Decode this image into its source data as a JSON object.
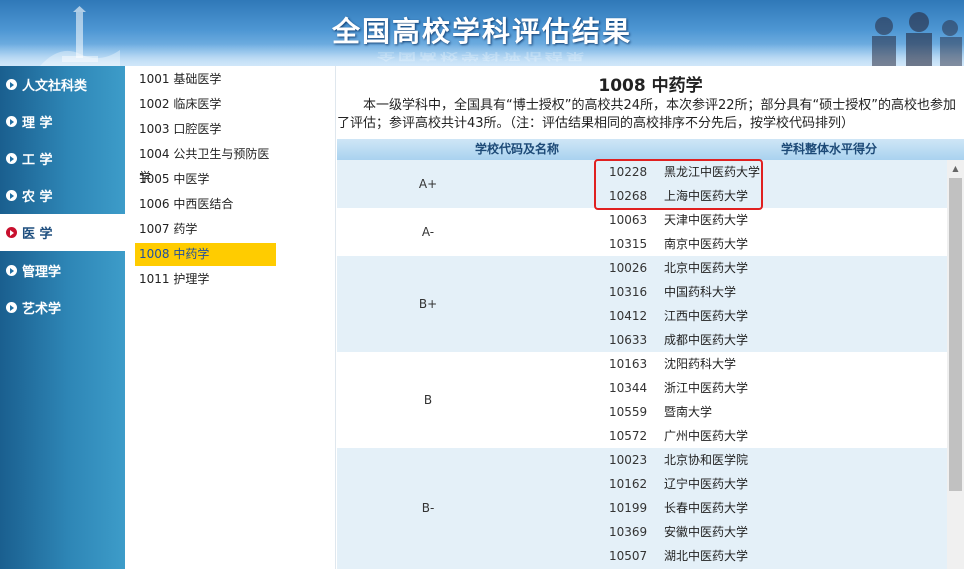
{
  "banner": {
    "title": "全国高校学科评估结果"
  },
  "left_nav": {
    "items": [
      {
        "label": "人文社科类",
        "active": false
      },
      {
        "label": "理 学",
        "active": false
      },
      {
        "label": "工 学",
        "active": false
      },
      {
        "label": "农 学",
        "active": false
      },
      {
        "label": "医 学",
        "active": true
      },
      {
        "label": "管理学",
        "active": false
      },
      {
        "label": "艺术学",
        "active": false
      }
    ]
  },
  "sub_list": {
    "items": [
      {
        "label": "1001 基础医学",
        "active": false
      },
      {
        "label": "1002 临床医学",
        "active": false
      },
      {
        "label": "1003 口腔医学",
        "active": false
      },
      {
        "label": "1004 公共卫生与预防医学",
        "active": false
      },
      {
        "label": "1005 中医学",
        "active": false
      },
      {
        "label": "1006 中西医结合",
        "active": false
      },
      {
        "label": "1007 药学",
        "active": false
      },
      {
        "label": "1008 中药学",
        "active": true
      },
      {
        "label": "1011 护理学",
        "active": false
      }
    ]
  },
  "main": {
    "heading": "1008 中药学",
    "description": "本一级学科中，全国具有“博士授权”的高校共24所，本次参评22所；部分具有“硕士授权”的高校也参加了评估；参评高校共计43所。（注：评估结果相同的高校排序不分先后，按学校代码排列）",
    "table": {
      "col_school": "学校代码及名称",
      "col_score": "学科整体水平得分",
      "groups": [
        {
          "grade": "A+",
          "shade": true,
          "rows": [
            {
              "code": "10228",
              "name": "黑龙江中医药大学"
            },
            {
              "code": "10268",
              "name": "上海中医药大学"
            }
          ]
        },
        {
          "grade": "A-",
          "shade": false,
          "rows": [
            {
              "code": "10063",
              "name": "天津中医药大学"
            },
            {
              "code": "10315",
              "name": "南京中医药大学"
            }
          ]
        },
        {
          "grade": "B+",
          "shade": true,
          "rows": [
            {
              "code": "10026",
              "name": "北京中医药大学"
            },
            {
              "code": "10316",
              "name": "中国药科大学"
            },
            {
              "code": "10412",
              "name": "江西中医药大学"
            },
            {
              "code": "10633",
              "name": "成都中医药大学"
            }
          ]
        },
        {
          "grade": "B",
          "shade": false,
          "rows": [
            {
              "code": "10163",
              "name": "沈阳药科大学"
            },
            {
              "code": "10344",
              "name": "浙江中医药大学"
            },
            {
              "code": "10559",
              "name": "暨南大学"
            },
            {
              "code": "10572",
              "name": "广州中医药大学"
            }
          ]
        },
        {
          "grade": "B-",
          "shade": true,
          "rows": [
            {
              "code": "10023",
              "name": "北京协和医学院"
            },
            {
              "code": "10162",
              "name": "辽宁中医药大学"
            },
            {
              "code": "10199",
              "name": "长春中医药大学"
            },
            {
              "code": "10369",
              "name": "安徽中医药大学"
            },
            {
              "code": "10507",
              "name": "湖北中医药大学"
            }
          ]
        }
      ]
    }
  },
  "colors": {
    "accent": "#ffcc00",
    "highlight_border": "#e02020",
    "nav_bg": "#2e86b6"
  }
}
